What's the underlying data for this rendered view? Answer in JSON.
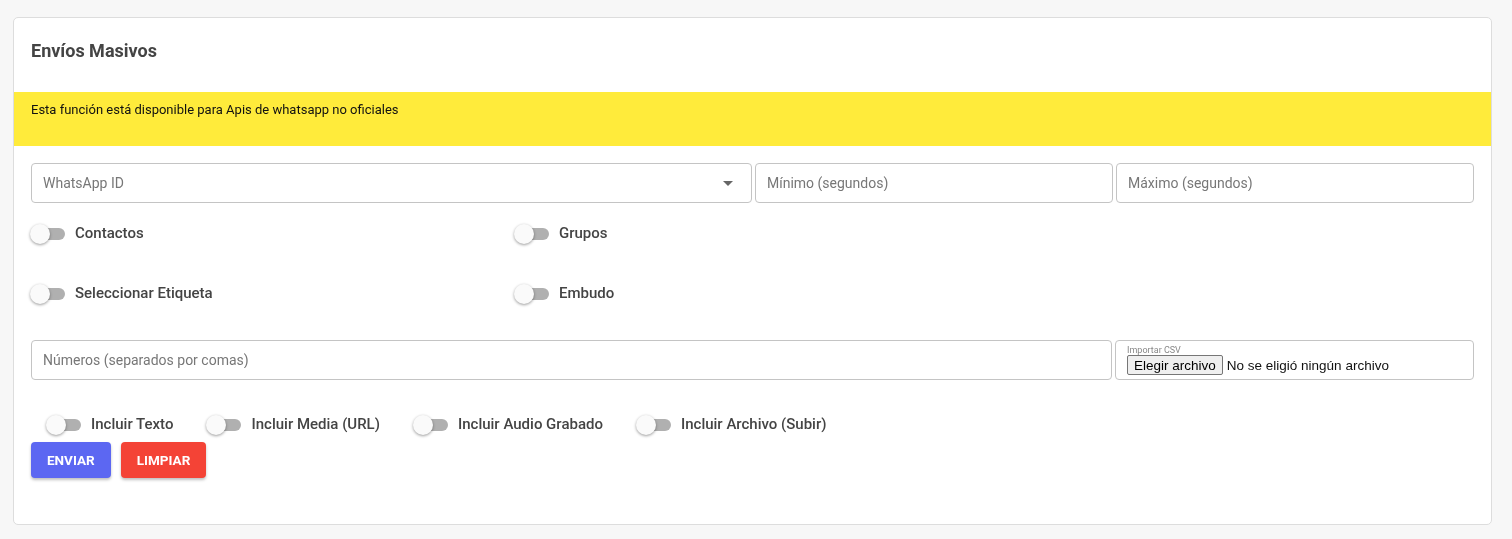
{
  "title": "Envíos Masivos",
  "notice": "Esta función está disponible para Apis de whatsapp no oficiales",
  "fields": [
    {
      "kind": "select",
      "placeholder": "WhatsApp ID"
    },
    {
      "kind": "text",
      "placeholder": "Mínimo (segundos)"
    },
    {
      "kind": "text",
      "placeholder": "Máximo (segundos)"
    }
  ],
  "targets": [
    [
      {
        "label": "Contactos",
        "on": false
      },
      {
        "label": "Grupos",
        "on": false
      }
    ],
    [
      {
        "label": "Seleccionar Etiqueta",
        "on": false
      },
      {
        "label": "Embudo",
        "on": false
      }
    ]
  ],
  "numbers_field": {
    "placeholder": "Números (separados por comas)"
  },
  "csv": {
    "label": "Importar CSV",
    "button": "Elegir archivo",
    "status": "No se eligió ningún archivo"
  },
  "includes": [
    {
      "label": "Incluir Texto",
      "on": false
    },
    {
      "label": "Incluir Media (URL)",
      "on": false
    },
    {
      "label": "Incluir Audio Grabado",
      "on": false
    },
    {
      "label": "Incluir Archivo (Subir)",
      "on": false
    }
  ],
  "buttons": [
    {
      "label": "ENVIAR",
      "kind": "primary"
    },
    {
      "label": "LIMPIAR",
      "kind": "danger"
    }
  ]
}
